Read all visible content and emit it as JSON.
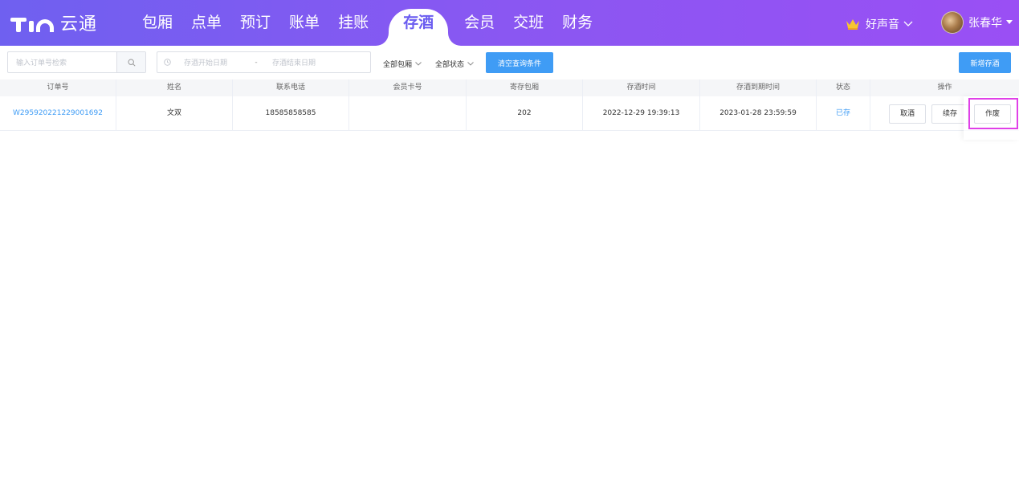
{
  "header": {
    "logo_text": "云通",
    "nav": [
      "包厢",
      "点单",
      "预订",
      "账单",
      "挂账",
      "存酒",
      "会员",
      "交班",
      "财务"
    ],
    "active_nav": "存酒",
    "store": "好声音",
    "user": "张春华"
  },
  "toolbar": {
    "search_placeholder": "输入订单号检索",
    "date_start_placeholder": "存酒开始日期",
    "date_sep": "-",
    "date_end_placeholder": "存酒结束日期",
    "room_filter": "全部包厢",
    "status_filter": "全部状态",
    "clear_button": "清空查询条件",
    "new_button": "新增存酒"
  },
  "table": {
    "columns": [
      "订单号",
      "姓名",
      "联系电话",
      "会员卡号",
      "寄存包厢",
      "存酒时间",
      "存酒到期时间",
      "状态",
      "操作"
    ],
    "rows": [
      {
        "order_no": "W295920221229001692",
        "name": "文双",
        "phone": "18585858585",
        "member_card": "",
        "room": "202",
        "store_time": "2022-12-29 19:39:13",
        "expire_time": "2023-01-28 23:59:59",
        "status": "已存",
        "actions": [
          "取酒",
          "续存",
          "作废"
        ]
      }
    ]
  },
  "colors": {
    "header_start": "#6f60f0",
    "header_end": "#9a4ff4",
    "primary": "#3f9cf5",
    "highlight": "#e040e8"
  }
}
